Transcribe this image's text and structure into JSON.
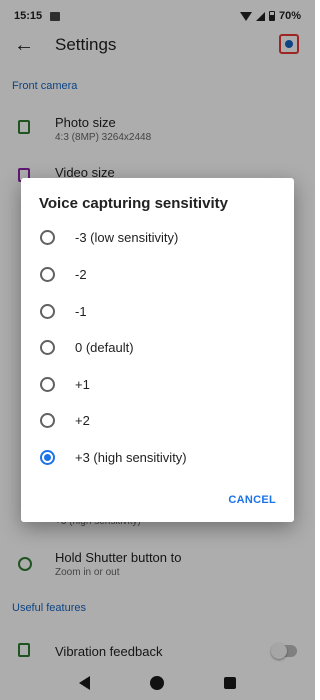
{
  "status_bar": {
    "time": "15:15",
    "battery": "70%"
  },
  "app_bar": {
    "title": "Settings"
  },
  "sections": {
    "front_camera": "Front camera",
    "useful_features": "Useful features"
  },
  "settings": {
    "photo_size": {
      "label": "Photo size",
      "value": "4:3 (8MP) 3264x2448"
    },
    "video_size": {
      "label": "Video size"
    },
    "behind_value": "+3 (high sensitivity)",
    "hold_shutter": {
      "label": "Hold Shutter button to",
      "value": "Zoom in or out"
    },
    "vibration": {
      "label": "Vibration feedback"
    }
  },
  "dialog": {
    "title": "Voice capturing sensitivity",
    "options": [
      {
        "label": "-3 (low sensitivity)",
        "selected": false
      },
      {
        "label": "-2",
        "selected": false
      },
      {
        "label": "-1",
        "selected": false
      },
      {
        "label": "0 (default)",
        "selected": false
      },
      {
        "label": "+1",
        "selected": false
      },
      {
        "label": "+2",
        "selected": false
      },
      {
        "label": "+3 (high sensitivity)",
        "selected": true
      }
    ],
    "cancel": "CANCEL"
  }
}
